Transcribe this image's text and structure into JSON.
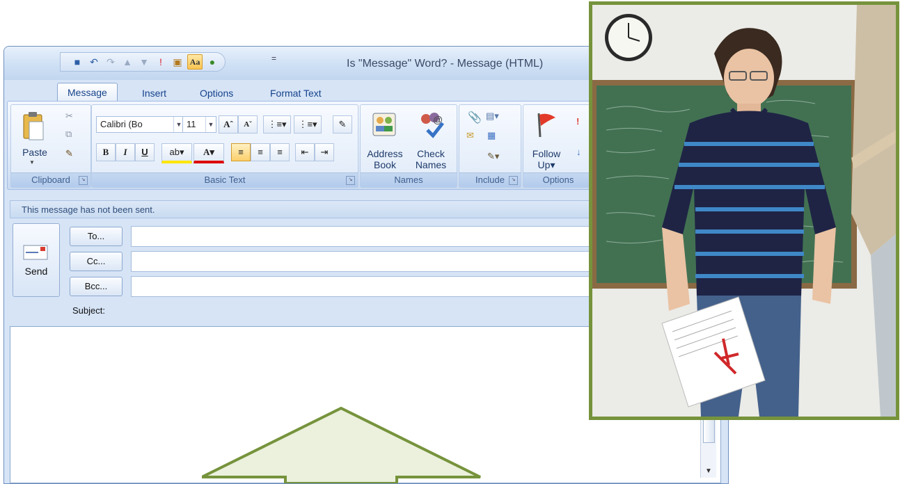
{
  "window": {
    "title": "Is \"Message\" Word? - Message (HTML)",
    "qat_more": "="
  },
  "tabs": [
    {
      "label": "Message",
      "active": true
    },
    {
      "label": "Insert",
      "active": false
    },
    {
      "label": "Options",
      "active": false
    },
    {
      "label": "Format Text",
      "active": false
    }
  ],
  "ribbon": {
    "clipboard": {
      "label": "Clipboard",
      "paste": "Paste"
    },
    "basic_text": {
      "label": "Basic Text",
      "font_name": "Calibri (Bo",
      "font_size": "11",
      "bold": "B",
      "italic": "I",
      "underline": "U",
      "font_color": "A"
    },
    "names": {
      "label": "Names",
      "address_book_line1": "Address",
      "address_book_line2": "Book",
      "check_names_line1": "Check",
      "check_names_line2": "Names"
    },
    "include": {
      "label": "Include"
    },
    "options": {
      "label": "Options",
      "follow_up_line1": "Follow",
      "follow_up_line2": "Up"
    }
  },
  "infobar": {
    "text": "This message has not been sent."
  },
  "compose": {
    "send": "Send",
    "to": "To...",
    "cc": "Cc...",
    "bcc": "Bcc...",
    "subject": "Subject:"
  },
  "colors": {
    "accent_green": "#76933c",
    "arrow_fill": "#ebf1dd",
    "ribbon_blue": "#d6e4f6"
  },
  "icons": [
    "office-button-icon",
    "save-icon",
    "undo-icon",
    "redo-icon",
    "up-icon",
    "down-icon",
    "importance-icon",
    "paste-icon",
    "theme-icon",
    "address-book-icon",
    "check-names-icon",
    "follow-up-flag-icon",
    "envelope-icon"
  ]
}
